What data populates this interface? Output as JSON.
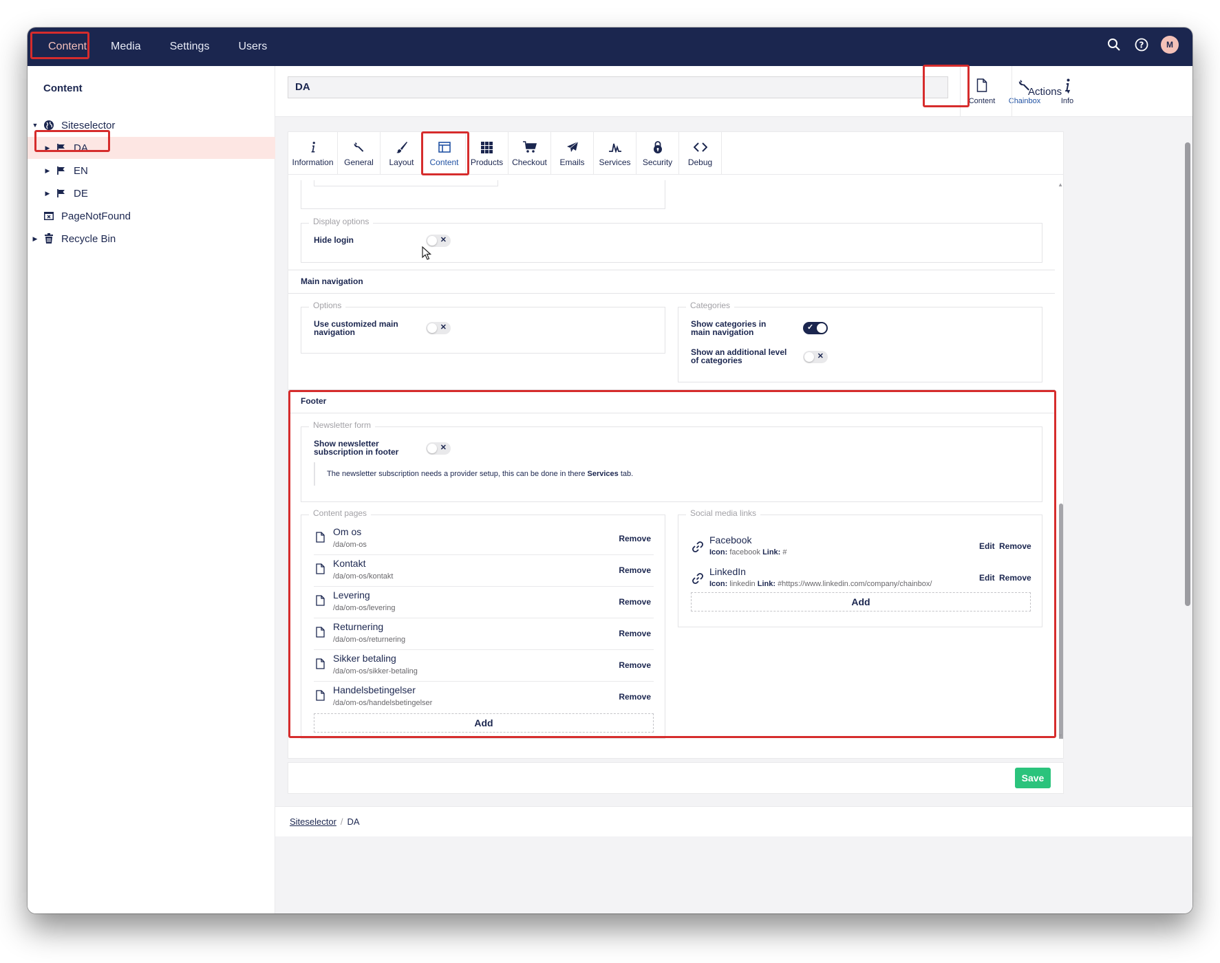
{
  "topbar": {
    "nav": [
      "Content",
      "Media",
      "Settings",
      "Users"
    ],
    "avatar_initial": "M",
    "background_color": "#1b264f"
  },
  "sidebar": {
    "title": "Content",
    "tree": [
      {
        "label": "Siteselector",
        "icon": "globe-icon"
      },
      {
        "label": "DA",
        "icon": "flag-icon"
      },
      {
        "label": "EN",
        "icon": "flag-icon"
      },
      {
        "label": "DE",
        "icon": "flag-icon"
      },
      {
        "label": "PageNotFound",
        "icon": "page-not-found-icon"
      },
      {
        "label": "Recycle Bin",
        "icon": "trash-icon"
      }
    ]
  },
  "editor": {
    "node_name": "DA",
    "app_tabs": [
      {
        "label": "Content",
        "icon": "document-icon"
      },
      {
        "label": "Chainbox",
        "icon": "wrench-icon"
      },
      {
        "label": "Info",
        "icon": "info-icon"
      }
    ],
    "actions_label": "Actions"
  },
  "sub_tabs": [
    {
      "label": "Information",
      "icon": "info-icon"
    },
    {
      "label": "General",
      "icon": "wrench-icon"
    },
    {
      "label": "Layout",
      "icon": "brush-icon"
    },
    {
      "label": "Content",
      "icon": "layout-icon"
    },
    {
      "label": "Products",
      "icon": "grid-icon"
    },
    {
      "label": "Checkout",
      "icon": "cart-icon"
    },
    {
      "label": "Emails",
      "icon": "paper-plane-icon"
    },
    {
      "label": "Services",
      "icon": "pulse-icon"
    },
    {
      "label": "Security",
      "icon": "lock-icon"
    },
    {
      "label": "Debug",
      "icon": "code-icon"
    }
  ],
  "display_options": {
    "legend": "Display options",
    "hide_login_label": "Hide login",
    "hide_login_enabled": false
  },
  "main_navigation": {
    "heading": "Main navigation",
    "options_legend": "Options",
    "use_customized_label": "Use customized main navigation",
    "use_customized_enabled": false,
    "categories_legend": "Categories",
    "show_categories_label": "Show categories in main navigation",
    "show_categories_enabled": true,
    "additional_level_label": "Show an additional level of categories",
    "additional_level_enabled": false
  },
  "footer": {
    "heading": "Footer",
    "newsletter_legend": "Newsletter form",
    "show_newsletter_label": "Show newsletter subscription in footer",
    "show_newsletter_enabled": false,
    "newsletter_note_prefix": "The newsletter subscription needs a provider setup, this can be done in there",
    "newsletter_note_link": "Services",
    "newsletter_note_suffix": "tab.",
    "content_pages_legend": "Content pages",
    "content_pages": [
      {
        "name": "Om os",
        "path": "/da/om-os"
      },
      {
        "name": "Kontakt",
        "path": "/da/om-os/kontakt"
      },
      {
        "name": "Levering",
        "path": "/da/om-os/levering"
      },
      {
        "name": "Returnering",
        "path": "/da/om-os/returnering"
      },
      {
        "name": "Sikker betaling",
        "path": "/da/om-os/sikker-betaling"
      },
      {
        "name": "Handelsbetingelser",
        "path": "/da/om-os/handelsbetingelser"
      }
    ],
    "remove_label": "Remove",
    "edit_label": "Edit",
    "add_label": "Add",
    "social_legend": "Social media links",
    "social_links": [
      {
        "name": "Facebook",
        "icon_label": "Icon:",
        "icon_value": "facebook",
        "link_label": "Link:",
        "link_value": "#"
      },
      {
        "name": "LinkedIn",
        "icon_label": "Icon:",
        "icon_value": "linkedin",
        "link_label": "Link:",
        "link_value": "#https://www.linkedin.com/company/chainbox/"
      }
    ]
  },
  "save_label": "Save",
  "breadcrumb": [
    "Siteselector",
    "DA"
  ],
  "colors": {
    "navy": "#1b264f",
    "save_green": "#2bc37c",
    "highlight_red": "#d62c2c",
    "selected_row": "#fde6e3"
  }
}
